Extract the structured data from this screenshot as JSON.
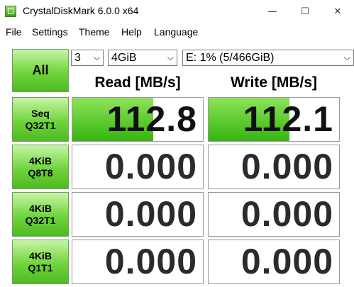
{
  "window": {
    "title": "CrystalDiskMark 6.0.0 x64",
    "controls": [
      "—",
      "☐",
      "✕"
    ]
  },
  "menu": [
    "File",
    "Settings",
    "Theme",
    "Help",
    "Language"
  ],
  "controls": {
    "all_label": "All",
    "count": "3",
    "size": "4GiB",
    "drive": "E: 1% (5/466GiB)"
  },
  "headers": {
    "read": "Read [MB/s]",
    "write": "Write [MB/s]"
  },
  "rows": [
    {
      "label1": "Seq",
      "label2": "Q32T1",
      "read": "112.8",
      "write": "112.1",
      "read_level": 0.62,
      "write_level": 0.62
    },
    {
      "label1": "4KiB",
      "label2": "Q8T8",
      "read": "0.000",
      "write": "0.000",
      "read_level": 0,
      "write_level": 0
    },
    {
      "label1": "4KiB",
      "label2": "Q32T1",
      "read": "0.000",
      "write": "0.000",
      "read_level": 0,
      "write_level": 0
    },
    {
      "label1": "4KiB",
      "label2": "Q1T1",
      "read": "0.000",
      "write": "0.000",
      "read_level": 0,
      "write_level": 0
    }
  ],
  "colors": {
    "button_green": "#4dbb1f",
    "bar_green": "#35b50f"
  }
}
